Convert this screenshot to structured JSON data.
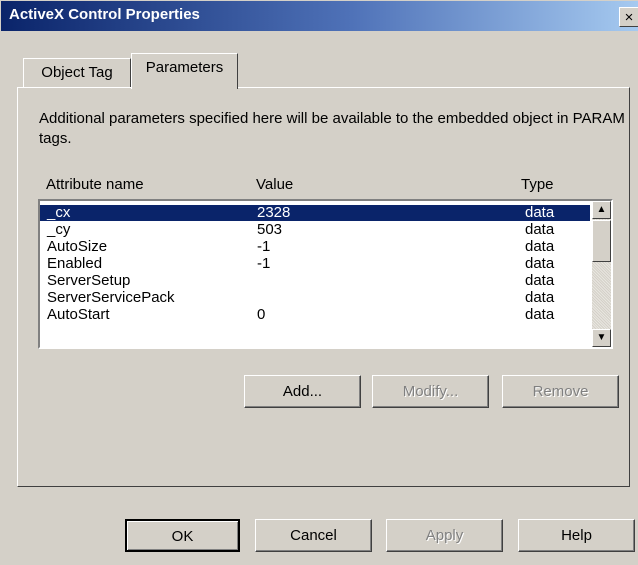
{
  "window": {
    "title": "ActiveX Control Properties",
    "close_glyph": "×"
  },
  "tabs": [
    {
      "label": "Object Tag",
      "selected": false
    },
    {
      "label": "Parameters",
      "selected": true
    }
  ],
  "description": "Additional parameters specified here will be available to the embedded object in PARAM tags.",
  "list": {
    "headers": {
      "attribute": "Attribute name",
      "value": "Value",
      "type": "Type"
    },
    "rows": [
      {
        "attribute": "_cx",
        "value": "2328",
        "type": "data",
        "selected": true
      },
      {
        "attribute": "_cy",
        "value": "503",
        "type": "data"
      },
      {
        "attribute": "AutoSize",
        "value": "-1",
        "type": "data"
      },
      {
        "attribute": "Enabled",
        "value": "-1",
        "type": "data"
      },
      {
        "attribute": "ServerSetup",
        "value": "",
        "type": "data"
      },
      {
        "attribute": "ServerServicePack",
        "value": "",
        "type": "data"
      },
      {
        "attribute": "AutoStart",
        "value": "0",
        "type": "data"
      }
    ]
  },
  "actions": {
    "add": "Add...",
    "modify": "Modify...",
    "remove": "Remove"
  },
  "footer": {
    "ok": "OK",
    "cancel": "Cancel",
    "apply": "Apply",
    "help": "Help"
  },
  "colors": {
    "face": "#d4d0c8",
    "selection": "#0a246a",
    "titlebar": "#0a246a"
  }
}
